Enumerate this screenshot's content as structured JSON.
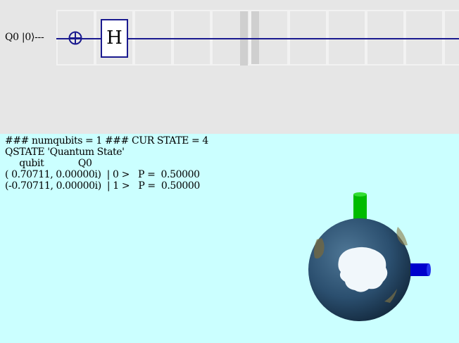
{
  "circuit": {
    "qubit_label": "Q0 |0⟩---",
    "gate_label": "H"
  },
  "state_panel": {
    "line1": "### numqubits = 1 ### CUR STATE = 4",
    "line2": "QSTATE 'Quantum State'",
    "line3": "     qubit            Q0",
    "line4": "( 0.70711, 0.00000i)  | 0 >   P =  0.50000",
    "line5": "(-0.70711, 0.00000i)  | 1 >   P =  0.50000"
  },
  "bloch": {
    "z_axis_color": "#00bb00",
    "x_axis_color": "#0000cc",
    "sphere_color": "#2b4f6f",
    "continent_color": "#f1f7fb"
  }
}
